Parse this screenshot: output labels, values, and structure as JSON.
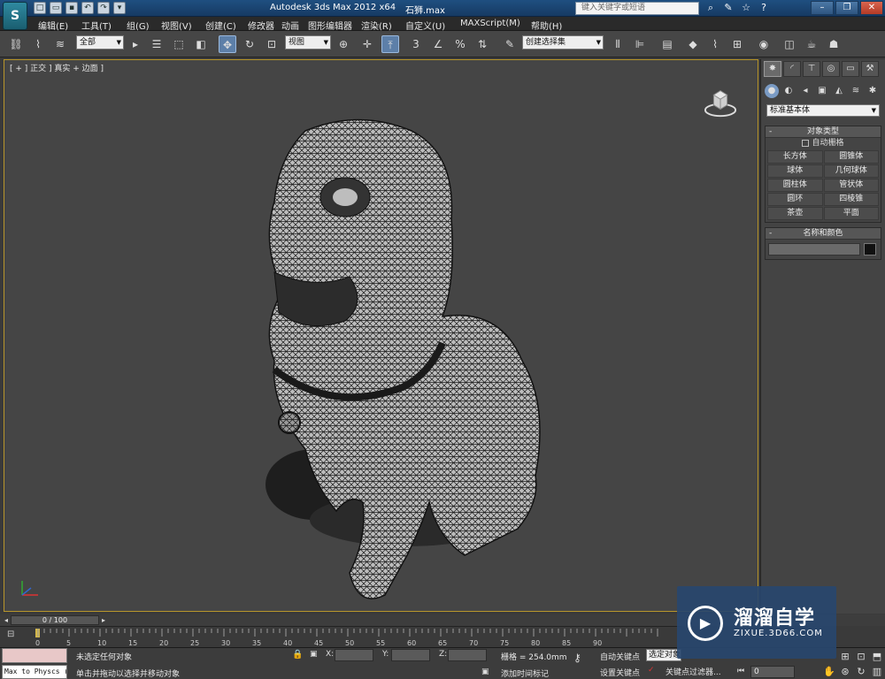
{
  "title": {
    "app": "Autodesk 3ds Max  2012 x64",
    "file": "石狮.max",
    "search_placeholder": "键入关键字或短语",
    "app_logo": "S"
  },
  "menu": [
    "编辑(E)",
    "工具(T)",
    "组(G)",
    "视图(V)",
    "创建(C)",
    "修改器",
    "动画",
    "图形编辑器",
    "渲染(R)",
    "自定义(U)",
    "MAXScript(M)",
    "帮助(H)"
  ],
  "toolbar": {
    "selection_filter": "全部",
    "reference_coord": "视图",
    "named_selection": "创建选择集"
  },
  "viewport": {
    "label": "[ + ] 正交 ] 真实 + 边面 ]"
  },
  "command_panel": {
    "category": "标准基本体",
    "object_type_title": "对象类型",
    "autogrid_label": "自动栅格",
    "objects": [
      "长方体",
      "圆锥体",
      "球体",
      "几何球体",
      "圆柱体",
      "管状体",
      "圆环",
      "四棱锥",
      "茶壶",
      "平面"
    ],
    "name_color_title": "名称和颜色"
  },
  "timeline": {
    "frame_counter": "0 / 100",
    "ticks": [
      "0",
      "5",
      "10",
      "15",
      "20",
      "25",
      "30",
      "35",
      "40",
      "45",
      "50",
      "55",
      "60",
      "65",
      "70",
      "75",
      "80",
      "85",
      "90"
    ]
  },
  "status": {
    "maxscript": "Max to Physcs (",
    "selection_status": "未选定任何对象",
    "prompt": "单击并拖动以选择并移动对象",
    "x_label": "X:",
    "y_label": "Y:",
    "z_label": "Z:",
    "grid": "栅格 = 254.0mm",
    "add_time_tag": "添加时间标记",
    "auto_key": "自动关键点",
    "set_key": "设置关键点",
    "selected_object": "选定对象",
    "key_filters": "关键点过滤器...",
    "current_frame": "0"
  },
  "watermark": {
    "brand": "溜溜自学",
    "url": "ZIXUE.3D66.COM"
  }
}
